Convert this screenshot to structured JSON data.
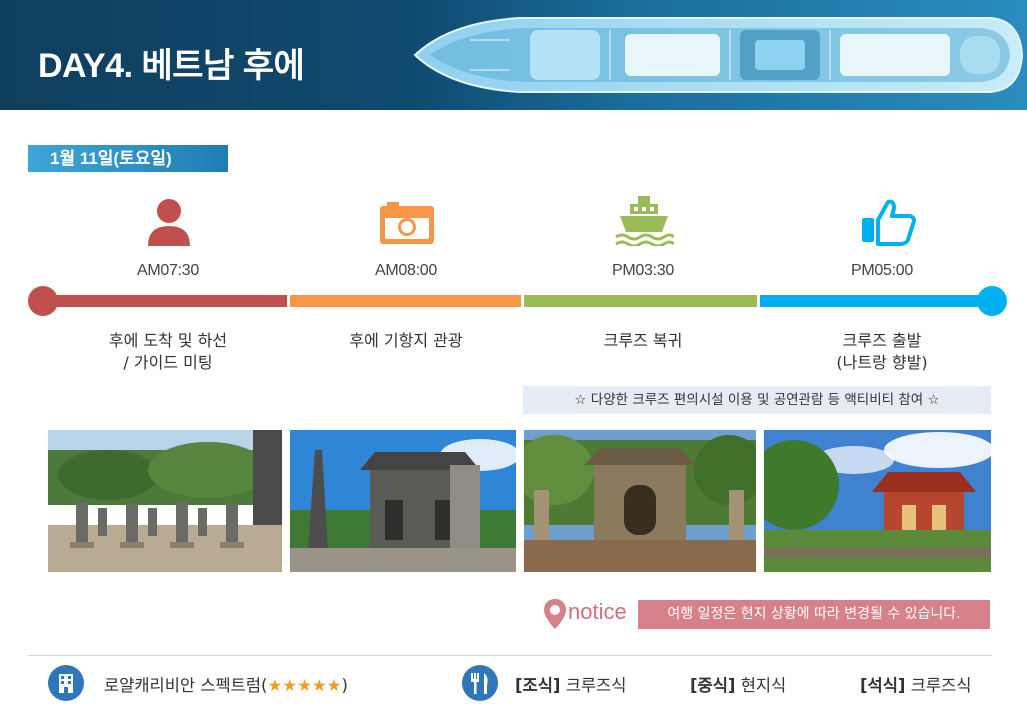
{
  "header": {
    "title": "DAY4. 베트남 후에"
  },
  "date": "1월 11일(토요일)",
  "timeline": [
    {
      "time": "AM07:30",
      "icon": "person-icon",
      "desc_line1": "후에 도착 및 하선",
      "desc_line2": "/ 가이드 미팅",
      "color": "#c0504d"
    },
    {
      "time": "AM08:00",
      "icon": "camera-icon",
      "desc_line1": "후에 기항지 관광",
      "desc_line2": "",
      "color": "#f79646"
    },
    {
      "time": "PM03:30",
      "icon": "ship-icon",
      "desc_line1": "크루즈 복귀",
      "desc_line2": "",
      "color": "#9bbb59"
    },
    {
      "time": "PM05:00",
      "icon": "thumbs-up-icon",
      "desc_line1": "크루즈 출발",
      "desc_line2": "(나트랑 향발)",
      "color": "#00b0f0"
    }
  ],
  "activity_note": "☆ 다양한 크루즈 편의시설 이용 및 공연관람 등 액티비티 참여 ☆",
  "notice": {
    "label": "notice",
    "text": "여행 일정은 현지 상황에 따라 변경될 수 있습니다."
  },
  "footer": {
    "hotel_name": "로얄캐리비안 스펙트럼(",
    "hotel_stars": "★★★★★",
    "hotel_close": ")",
    "breakfast_label": "[조식]",
    "breakfast_value": " 크루즈식",
    "lunch_label": "[중식]",
    "lunch_value": " 현지식",
    "dinner_label": "[석식]",
    "dinner_value": " 크루즈식"
  }
}
